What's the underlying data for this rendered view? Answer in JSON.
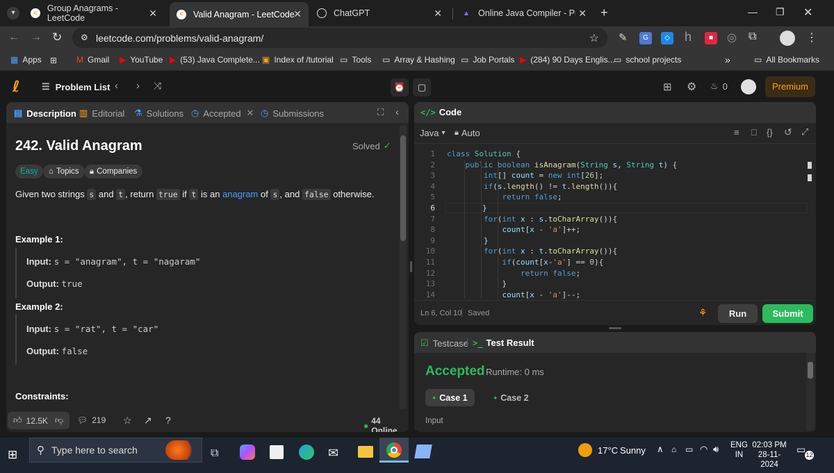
{
  "browser": {
    "tabs": [
      {
        "title": "Group Anagrams - LeetCode",
        "active": false
      },
      {
        "title": "Valid Anagram - LeetCode",
        "active": true
      },
      {
        "title": "ChatGPT",
        "active": false
      },
      {
        "title": "Online Java Compiler - Program",
        "active": false
      }
    ],
    "url": "leetcode.com/problems/valid-anagram/",
    "bookmarks": [
      "Apps",
      "Gmail",
      "YouTube",
      "(53) Java Complete...",
      "Index of /tutorial",
      "Tools",
      "Array & Hashing",
      "Job Portals",
      "(284) 90 Days Englis...",
      "school projects"
    ],
    "all_bookmarks": "All Bookmarks"
  },
  "leetcode": {
    "problem_list": "Problem List",
    "streak": "0",
    "premium": "Premium",
    "left_tabs": [
      "Description",
      "Editorial",
      "Solutions",
      "Accepted",
      "Submissions"
    ],
    "title": "242. Valid Anagram",
    "solved": "Solved",
    "difficulty": "Easy",
    "topics": "Topics",
    "companies": "Companies",
    "desc": {
      "p1": "Given two strings",
      "s": "s",
      "and": "and",
      "t": "t",
      "return": ", return",
      "true": "true",
      "if": "if",
      "is_an": "is an",
      "anagram": "anagram",
      "of": "of",
      "and2": ", and",
      "false": "false",
      "otherwise": "otherwise."
    },
    "examples": [
      {
        "label": "Example 1:",
        "input_label": "Input:",
        "input": "s = \"anagram\", t = \"nagaram\"",
        "output_label": "Output:",
        "output": "true"
      },
      {
        "label": "Example 2:",
        "input_label": "Input:",
        "input": "s = \"rat\", t = \"car\"",
        "output_label": "Output:",
        "output": "false"
      }
    ],
    "constraints": "Constraints:",
    "likes": "12.5K",
    "comments": "219",
    "online": "44 Online",
    "code_title": "Code",
    "language": "Java",
    "auto": "Auto",
    "status_pos": "Ln 6, Col 10",
    "saved": "Saved",
    "run": "Run",
    "submit": "Submit",
    "testcase_tab": "Testcase",
    "result_tab": "Test Result",
    "result": "Accepted",
    "runtime": "Runtime: 0 ms",
    "cases": [
      "Case 1",
      "Case 2"
    ],
    "input_label": "Input"
  },
  "code_lines": [
    "class Solution {",
    "    public boolean isAnagram(String s, String t) {",
    "        int[] count = new int[26];",
    "        if(s.length() != t.length()){",
    "            return false;",
    "        }",
    "        for(int x : s.toCharArray()){",
    "            count[x - 'a']++;",
    "        }",
    "        for(int x : t.toCharArray()){",
    "            if(count[x-'a'] == 0){",
    "                return false;",
    "            }",
    "            count[x - 'a']--;"
  ],
  "taskbar": {
    "search": "Type here to search",
    "temp": "17°C",
    "weather": "Sunny",
    "lang1": "ENG",
    "lang2": "IN",
    "time": "02:03 PM",
    "date": "28-11-2024",
    "notif": "12"
  },
  "colors": {
    "accent": "#ffa116",
    "green": "#2cbb5d",
    "easy": "#00b8a3"
  }
}
